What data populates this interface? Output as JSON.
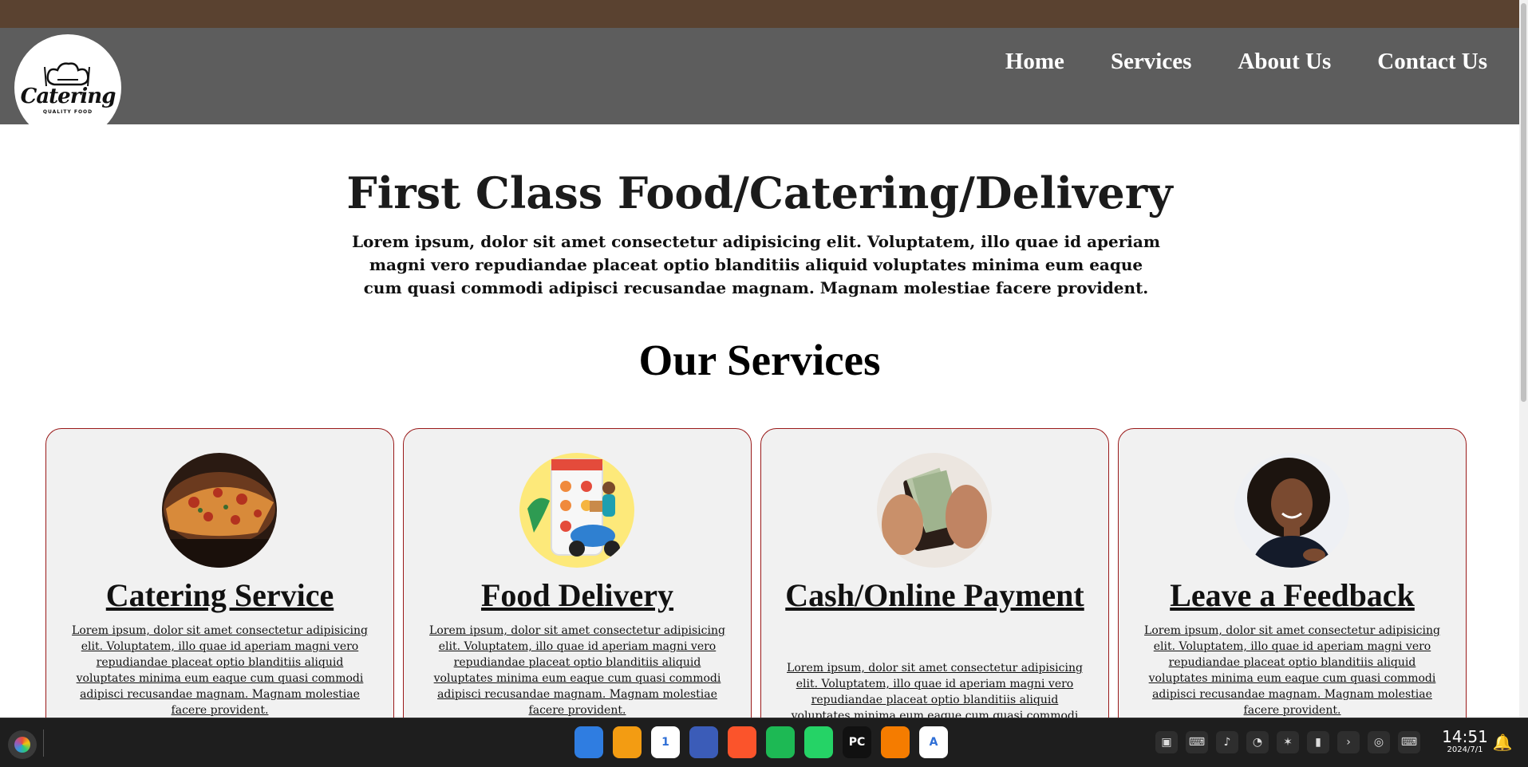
{
  "header": {
    "logo": {
      "word": "Catering",
      "tagline": "QUALITY FOOD"
    },
    "nav": [
      "Home",
      "Services",
      "About Us",
      "Contact Us"
    ]
  },
  "hero": {
    "title": "First Class Food/Catering/Delivery",
    "text": "Lorem ipsum, dolor sit amet consectetur adipisicing elit. Voluptatem, illo quae id aperiam magni vero repudiandae placeat optio blanditiis aliquid voluptates minima eum eaque cum quasi commodi adipisci recusandae magnam. Magnam molestiae facere provident."
  },
  "services": {
    "title": "Our Services",
    "cards": [
      {
        "title": "Catering Service",
        "image": "pizza-photo",
        "text": "Lorem ipsum, dolor sit amet consectetur adipisicing elit. Voluptatem, illo quae id aperiam magni vero repudiandae placeat optio blanditiis aliquid voluptates minima eum eaque cum quasi commodi adipisci recusandae magnam. Magnam molestiae facere provident."
      },
      {
        "title": "Food Delivery",
        "image": "delivery-scooter-illustration",
        "text": "Lorem ipsum, dolor sit amet consectetur adipisicing elit. Voluptatem, illo quae id aperiam magni vero repudiandae placeat optio blanditiis aliquid voluptates minima eum eaque cum quasi commodi adipisci recusandae magnam. Magnam molestiae facere provident."
      },
      {
        "title": "Cash/Online Payment",
        "image": "wallet-cash-photo",
        "text": "Lorem ipsum, dolor sit amet consectetur adipisicing elit. Voluptatem, illo quae id aperiam magni vero repudiandae placeat optio blanditiis aliquid voluptates minima eum eaque cum quasi commodi adipisci recusandae magnam."
      },
      {
        "title": "Leave a Feedback",
        "image": "smiling-woman-photo",
        "text": "Lorem ipsum, dolor sit amet consectetur adipisicing elit. Voluptatem, illo quae id aperiam magni vero repudiandae placeat optio blanditiis aliquid voluptates minima eum eaque cum quasi commodi adipisci recusandae magnam. Magnam molestiae facere provident."
      }
    ]
  },
  "taskbar": {
    "apps": [
      {
        "name": "finder-icon",
        "color": "#2f7de1"
      },
      {
        "name": "photos-icon",
        "color": "#f39c12"
      },
      {
        "name": "calendar-icon",
        "color": "#ffffff",
        "label": "1"
      },
      {
        "name": "settings-icon",
        "color": "#3b5cb8"
      },
      {
        "name": "brave-browser-icon",
        "color": "#fb542b"
      },
      {
        "name": "spotify-icon",
        "color": "#1db954"
      },
      {
        "name": "whatsapp-icon",
        "color": "#25d366"
      },
      {
        "name": "pycharm-icon",
        "color": "#111111",
        "label": "PC"
      },
      {
        "name": "app-store-icon",
        "color": "#f57c00"
      },
      {
        "name": "app-installer-icon",
        "color": "#ffffff",
        "label": "A"
      }
    ],
    "tray": [
      "cube-icon",
      "keyboard-icon",
      "volume-icon",
      "wifi-icon",
      "bluetooth-icon",
      "battery-icon",
      "chevron-right-icon",
      "speedometer-icon",
      "input-method-icon"
    ],
    "time": "14:51",
    "date": "2024/7/1"
  }
}
